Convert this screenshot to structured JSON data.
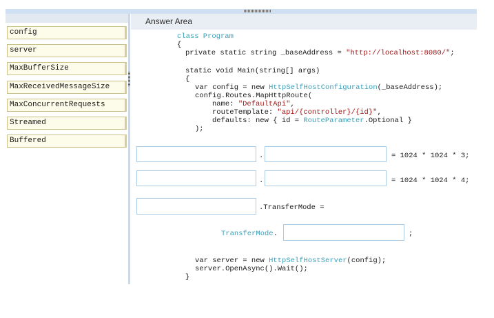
{
  "tokens": [
    "config",
    "server",
    "MaxBufferSize",
    "MaxReceivedMessageSize",
    "MaxConcurrentRequests",
    "Streamed",
    "Buffered"
  ],
  "answer": {
    "title": "Answer Area",
    "line1": "class Program",
    "line2": "{",
    "line3_a": "private static string _baseAddress = ",
    "line3_b": "\"http://localhost:8080/\"",
    "line3_c": ";",
    "line4": "static void Main(string[] args)",
    "line5": "{",
    "line6_a": "var config = new ",
    "line6_b": "HttpSelfHostConfiguration",
    "line6_c": "(_baseAddress);",
    "line7": "config.Routes.MapHttpRoute(",
    "line8_a": "name: ",
    "line8_b": "\"DefaultApi\"",
    "line8_c": ",",
    "line9_a": "routeTemplate: ",
    "line9_b": "\"api/{controller}/{id}\"",
    "line9_c": ",",
    "line10_a": "defaults: new { id = ",
    "line10_b": "RouteParameter",
    "line10_c": ".Optional }",
    "line11": ");",
    "dot": ".",
    "expr1": "= 1024 * 1024 * 3;",
    "expr2": "= 1024 * 1024 * 4;",
    "transfer": ".TransferMode =",
    "transfer_type": "TransferMode",
    "semicolon": ";",
    "line_server_a": "var server = new ",
    "line_server_b": "HttpSelfHostServer",
    "line_server_c": "(config);",
    "line_open": "server.OpenAsync().Wait();",
    "line_close": "}"
  }
}
